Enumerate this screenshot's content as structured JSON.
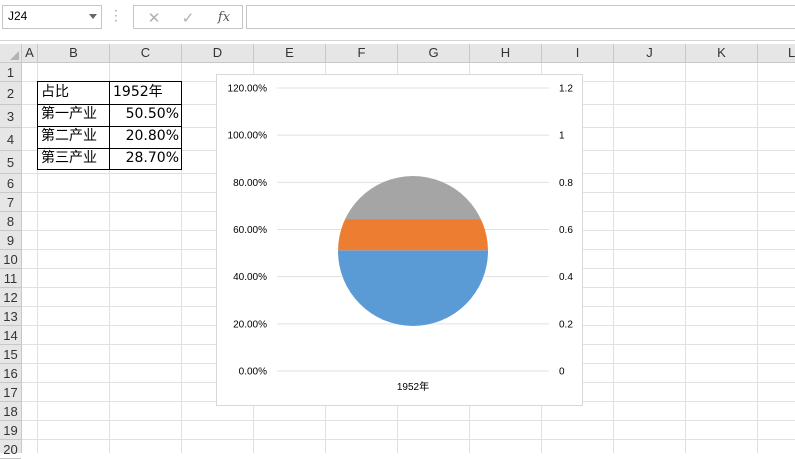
{
  "formula_bar": {
    "name_box_value": "J24",
    "cancel_icon": "✕",
    "confirm_icon": "✓",
    "fx_label": "fx",
    "formula_value": ""
  },
  "sheet": {
    "columns": [
      "A",
      "B",
      "C",
      "D",
      "E",
      "F",
      "G",
      "H",
      "I",
      "J",
      "K",
      "L"
    ],
    "rows": [
      "1",
      "2",
      "3",
      "4",
      "5",
      "6",
      "7",
      "8",
      "9",
      "10",
      "11",
      "12",
      "13",
      "14",
      "15",
      "16",
      "17",
      "18",
      "19",
      "20"
    ],
    "table": {
      "header": [
        "占比",
        "1952年"
      ],
      "rows": [
        [
          "第一产业",
          "50.50%"
        ],
        [
          "第二产业",
          "20.80%"
        ],
        [
          "第三产业",
          "28.70%"
        ]
      ]
    }
  },
  "chart_data": {
    "type": "pie",
    "category": "1952年",
    "series": [
      {
        "name": "第一产业",
        "value": 0.505,
        "color": "#5b9bd5"
      },
      {
        "name": "第二产业",
        "value": 0.208,
        "color": "#ed7d31"
      },
      {
        "name": "第三产业",
        "value": 0.287,
        "color": "#a5a5a5"
      }
    ],
    "left_axis_ticks": [
      "120.00%",
      "100.00%",
      "80.00%",
      "60.00%",
      "40.00%",
      "20.00%",
      "0.00%"
    ],
    "right_axis_ticks": [
      "1.2",
      "1",
      "0.8",
      "0.6",
      "0.4",
      "0.2",
      "0"
    ],
    "ylim": [
      0,
      1.2
    ],
    "x_label": "1952年",
    "grid": true
  }
}
